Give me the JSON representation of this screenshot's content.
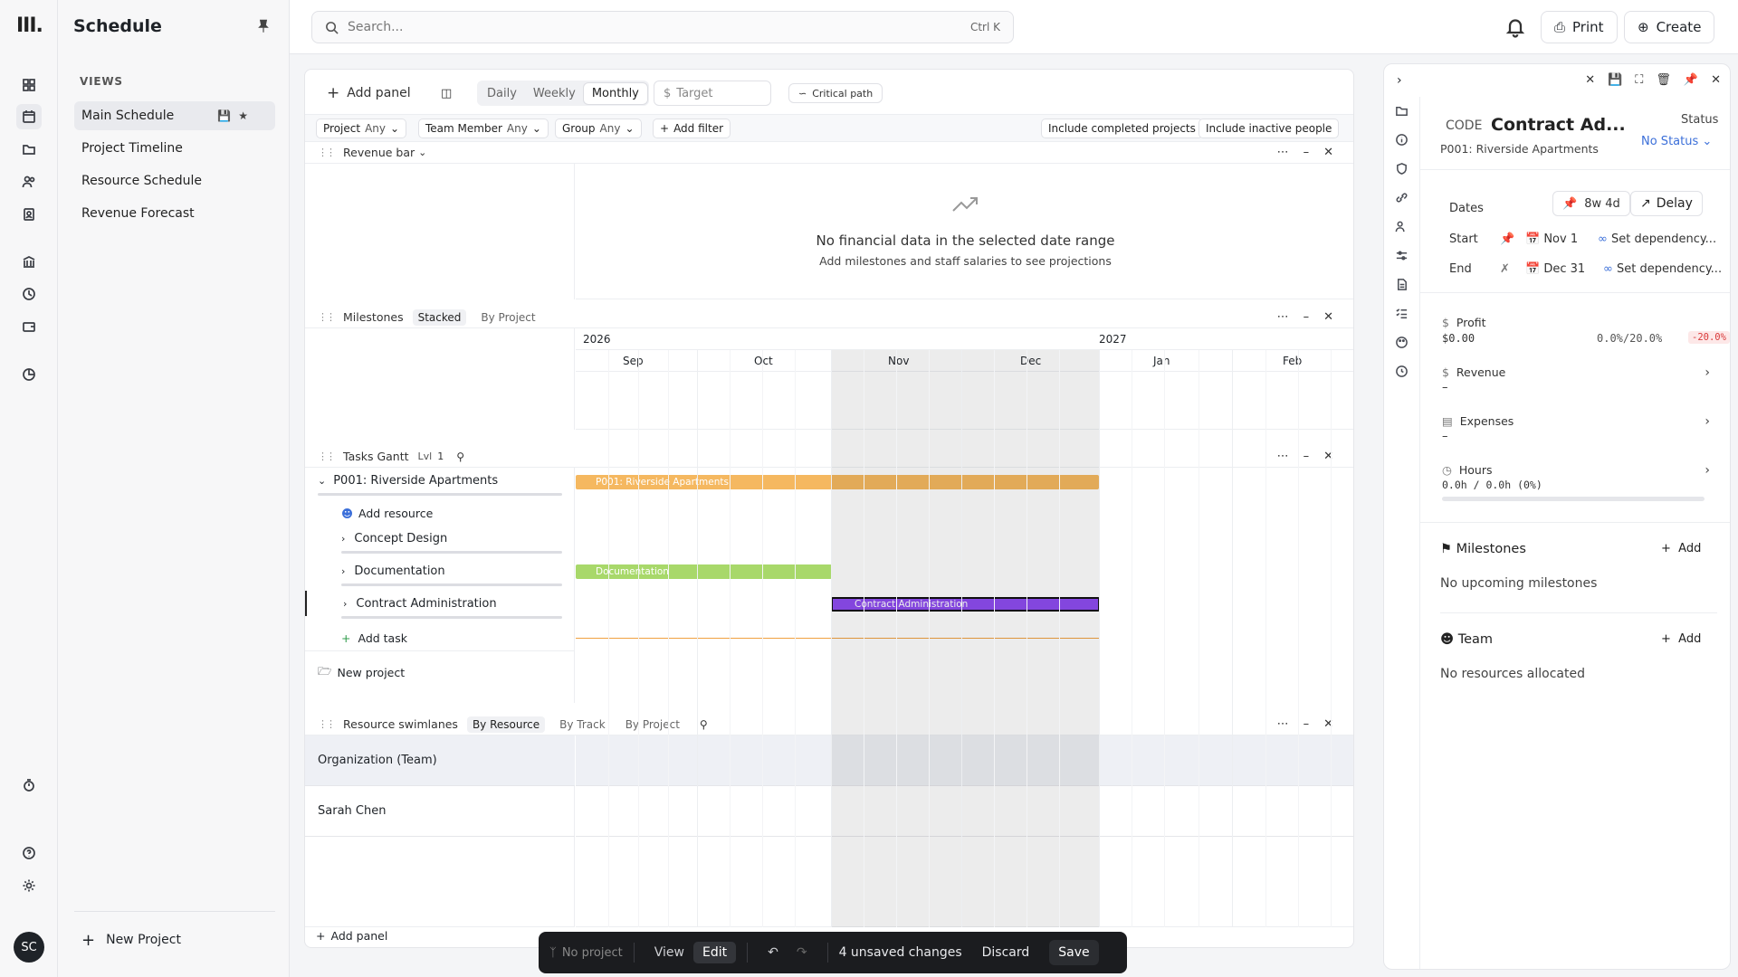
{
  "app": {
    "logo": "III.",
    "user_initials": "SC"
  },
  "sidebar": {
    "title": "Schedule",
    "views_label": "VIEWS",
    "items": [
      {
        "label": "Main Schedule"
      },
      {
        "label": "Project Timeline"
      },
      {
        "label": "Resource Schedule"
      },
      {
        "label": "Revenue Forecast"
      }
    ],
    "new_project": "New Project"
  },
  "topbar": {
    "search_placeholder": "Search...",
    "search_shortcut": "Ctrl K",
    "print": "Print",
    "create": "Create"
  },
  "toolbar": {
    "add_panel": "Add panel",
    "scale": [
      "Daily",
      "Weekly",
      "Monthly"
    ],
    "scale_selected": "Monthly",
    "target_placeholder": "Target",
    "critical_path": "Critical path"
  },
  "filters": {
    "project": {
      "label": "Project",
      "value": "Any"
    },
    "team_member": {
      "label": "Team Member",
      "value": "Any"
    },
    "group": {
      "label": "Group",
      "value": "Any"
    },
    "add_filter": "Add filter",
    "include_completed": "Include completed projects",
    "include_inactive": "Include inactive people"
  },
  "revenue_panel": {
    "title": "Revenue bar",
    "empty_title": "No financial data in the selected date range",
    "empty_sub": "Add milestones and staff salaries to see projections"
  },
  "milestones_panel": {
    "title": "Milestones",
    "tabs": [
      "Stacked",
      "By Project"
    ],
    "years": [
      "2026",
      "2027"
    ],
    "months": [
      "Sep",
      "Oct",
      "Nov",
      "Dec",
      "Jan",
      "Feb"
    ]
  },
  "gantt_panel": {
    "title": "Tasks Gantt",
    "level_label": "Lvl",
    "level_value": "1",
    "project": "P001: Riverside Apartments",
    "add_resource": "Add resource",
    "tasks": [
      "Concept Design",
      "Documentation",
      "Contract Administration"
    ],
    "add_task": "Add task",
    "new_project": "New project",
    "bars": {
      "project": "P001: Riverside Apartments",
      "documentation": "Documentation",
      "contract": "Contract Administration"
    }
  },
  "swimlanes_panel": {
    "title": "Resource swimlanes",
    "tabs": [
      "By Resource",
      "By Track",
      "By Project"
    ],
    "rows": [
      "Organization (Team)",
      "Sarah Chen"
    ]
  },
  "add_panel_bottom": "Add panel",
  "detail": {
    "code_label": "CODE",
    "title": "Contract Ad...",
    "subtitle": "P001: Riverside Apartments",
    "status_label": "Status",
    "status_value": "No Status",
    "dates_label": "Dates",
    "duration": "8w 4d",
    "delay": "Delay",
    "start_label": "Start",
    "start_value": "Nov 1",
    "end_label": "End",
    "end_value": "Dec 31",
    "set_dependency": "Set dependency...",
    "profit_label": "Profit",
    "profit_value": "$0.00",
    "profit_ratio": "0.0%/20.0%",
    "profit_delta": "-20.0%",
    "revenue_label": "Revenue",
    "revenue_value": "–",
    "expenses_label": "Expenses",
    "expenses_value": "–",
    "hours_label": "Hours",
    "hours_value": "0.0h / 0.0h (0%)",
    "milestones_label": "Milestones",
    "milestones_add": "Add",
    "milestones_empty": "No upcoming milestones",
    "team_label": "Team",
    "team_add": "Add",
    "team_empty": "No resources allocated"
  },
  "editbar": {
    "project": "No project",
    "view": "View",
    "edit": "Edit",
    "unsaved": "4 unsaved changes",
    "discard": "Discard",
    "save": "Save"
  },
  "colors": {
    "project_bar": "#f5b860",
    "documentation_bar": "#a8d86a",
    "contract_bar": "#8e4cf0",
    "today_line": "#f0a040",
    "profit_delta": "#d93a3a"
  }
}
